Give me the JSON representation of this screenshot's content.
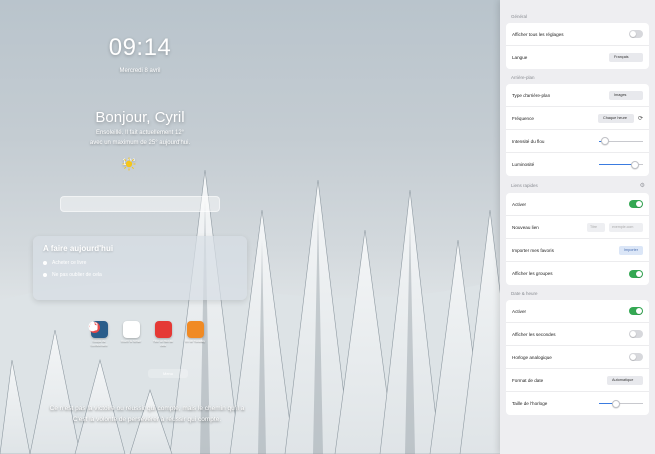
{
  "lockscreen": {
    "time": "09:14",
    "date": "Mercredi 8 avril",
    "greeting": "Bonjour, Cyril",
    "weather_line1": "Ensoleillé. Il fait actuellement 12°",
    "weather_line2": "avec un maximum de 25° aujourd'hui.",
    "temperature": "12°",
    "todo": {
      "title": "A faire aujourd'hui",
      "items": [
        "Acheter ce livre",
        "Ne pas oublier de cela"
      ]
    },
    "shortcuts": [
      {
        "label": "Coupe de Confinement",
        "icon": "hourglass-icon",
        "color": "#2a5d8a"
      },
      {
        "label": "Ouvrir le fichier",
        "icon": "target-icon",
        "color": "#e84848"
      },
      {
        "label": "Tirer un filet de cela",
        "icon": "flame-icon",
        "color": "#e53935"
      },
      {
        "label": "On dit Tuesday",
        "icon": "power-icon",
        "color": "#f08a24"
      }
    ],
    "more_label": "Menu",
    "quote_line1": "Ce n'est pas la victoire ou réussir qui compte, mais le chemin qu'il a",
    "quote_line2": "C'est la volonté de persévérer à réussir qui compte."
  },
  "settings": {
    "general": {
      "title": "Général",
      "show_all_label": "Afficher tous les réglages",
      "show_all": false,
      "language_label": "Langue",
      "language_value": "Français"
    },
    "background": {
      "title": "Arrière-plan",
      "type_label": "Type d'arrière-plan",
      "type_value": "Images",
      "frequency_label": "Fréquence",
      "frequency_value": "Chaque heure",
      "blur_label": "Intensité du flou",
      "blur_level": 0.05,
      "brightness_label": "Luminosité",
      "brightness_level": 0.9
    },
    "quick_links": {
      "title": "Liens rapides",
      "enable_label": "Activer",
      "enable": true,
      "new_link_label": "Nouveau lien",
      "new_link_title_placeholder": "Titre",
      "new_link_url_placeholder": "exemple.com",
      "import_label": "Importer mes favoris",
      "import_button": "Importer",
      "groups_label": "Afficher les groupes",
      "groups": true
    },
    "datetime": {
      "title": "Date & heure",
      "enable_label": "Activer",
      "enable": true,
      "seconds_label": "Afficher les secondes",
      "seconds": false,
      "analog_label": "Horloge analogique",
      "analog": false,
      "format_label": "Format de date",
      "format_value": "Automatique",
      "size_label": "Taille de l'horloge",
      "size_level": 0.35
    }
  },
  "colors": {
    "toggle_on": "#34a853",
    "slider_fill": "#3a7be0",
    "panel_bg": "#eeeef1"
  }
}
